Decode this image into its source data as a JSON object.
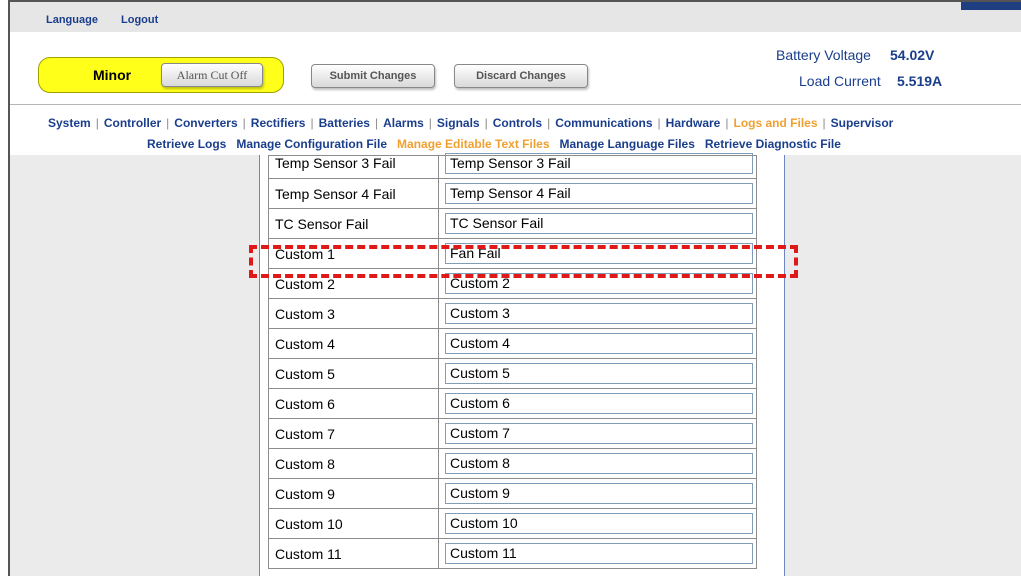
{
  "topbar": {
    "language": "Language",
    "logout": "Logout"
  },
  "alarm": {
    "status": "Minor",
    "cut_off_label": "Alarm Cut Off",
    "status_color": "#ffff1a"
  },
  "actions": {
    "submit": "Submit Changes",
    "discard": "Discard Changes"
  },
  "meters": {
    "battery_voltage_label": "Battery Voltage",
    "battery_voltage_value": "54.02V",
    "load_current_label": "Load Current",
    "load_current_value": "5.519A"
  },
  "nav": {
    "main": [
      "System",
      "Controller",
      "Converters",
      "Rectifiers",
      "Batteries",
      "Alarms",
      "Signals",
      "Controls",
      "Communications",
      "Hardware",
      "Logs and Files",
      "Supervisor"
    ],
    "active_main": "Logs and Files",
    "sub": [
      "Retrieve Logs",
      "Manage Configuration File",
      "Manage Editable Text Files",
      "Manage Language Files",
      "Retrieve Diagnostic File"
    ],
    "active_sub": "Manage Editable Text Files",
    "active_color": "#f0a030"
  },
  "rows": [
    {
      "label": "Temp Sensor 3 Fail",
      "value": "Temp Sensor 3 Fail"
    },
    {
      "label": "Temp Sensor 4 Fail",
      "value": "Temp Sensor 4 Fail"
    },
    {
      "label": "TC Sensor Fail",
      "value": "TC Sensor Fail"
    },
    {
      "label": "Custom 1",
      "value": "Fan Fail"
    },
    {
      "label": "Custom 2",
      "value": "Custom 2"
    },
    {
      "label": "Custom 3",
      "value": "Custom 3"
    },
    {
      "label": "Custom 4",
      "value": "Custom 4"
    },
    {
      "label": "Custom 5",
      "value": "Custom 5"
    },
    {
      "label": "Custom 6",
      "value": "Custom 6"
    },
    {
      "label": "Custom 7",
      "value": "Custom 7"
    },
    {
      "label": "Custom 8",
      "value": "Custom 8"
    },
    {
      "label": "Custom 9",
      "value": "Custom 9"
    },
    {
      "label": "Custom 10",
      "value": "Custom 10"
    },
    {
      "label": "Custom 11",
      "value": "Custom 11"
    }
  ],
  "highlight_color": "#e01818"
}
